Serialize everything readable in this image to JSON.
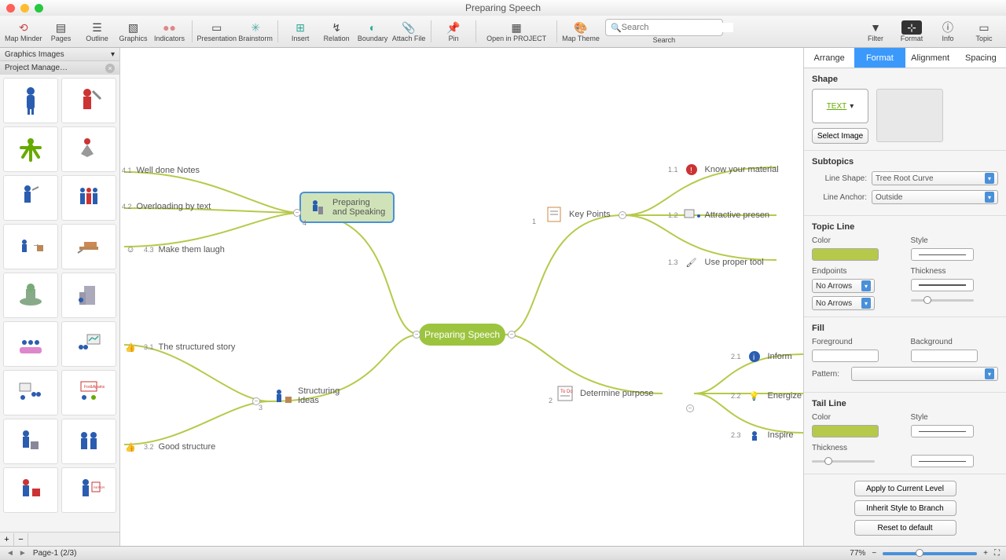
{
  "window": {
    "title": "Preparing Speech"
  },
  "toolbar": {
    "map_minder": "Map Minder",
    "pages": "Pages",
    "outline": "Outline",
    "graphics": "Graphics",
    "indicators": "Indicators",
    "presentation": "Presentation",
    "brainstorm": "Brainstorm",
    "insert": "Insert",
    "relation": "Relation",
    "boundary": "Boundary",
    "attach_file": "Attach File",
    "pin": "Pin",
    "open_project": "Open in PROJECT",
    "map_theme": "Map Theme",
    "search": "Search",
    "search_placeholder": "Search",
    "filter": "Filter",
    "format": "Format",
    "info": "Info",
    "topic": "Topic"
  },
  "left": {
    "header": "Graphics Images",
    "tab": "Project Manage…"
  },
  "mindmap": {
    "central": "Preparing Speech",
    "n4": {
      "num": "4",
      "label": "Preparing\nand Speaking"
    },
    "n41": {
      "num": "4.1",
      "label": "Well done Notes"
    },
    "n42": {
      "num": "4.2",
      "label": "Overloading by text"
    },
    "n43": {
      "num": "4.3",
      "label": "Make them laugh"
    },
    "n3": {
      "num": "3",
      "label": "Structuring\nIdeas"
    },
    "n31": {
      "num": "3.1",
      "label": "The structured story"
    },
    "n32": {
      "num": "3.2",
      "label": "Good structure"
    },
    "n1": {
      "num": "1",
      "label": "Key Points"
    },
    "n11": {
      "num": "1.1",
      "label": "Know your material"
    },
    "n12": {
      "num": "1.2",
      "label": "Attractive presen"
    },
    "n13": {
      "num": "1.3",
      "label": "Use proper tool"
    },
    "n2": {
      "num": "2",
      "label": "Determine purpose"
    },
    "n21": {
      "num": "2.1",
      "label": "Inform"
    },
    "n22": {
      "num": "2.2",
      "label": "Energize"
    },
    "n23": {
      "num": "2.3",
      "label": "Inspire"
    }
  },
  "right": {
    "tabs": [
      "Arrange",
      "Format",
      "Alignment",
      "Spacing"
    ],
    "shape_h": "Shape",
    "shape_text": "TEXT",
    "select_image": "Select Image",
    "subtopics_h": "Subtopics",
    "line_shape_l": "Line Shape:",
    "line_shape_v": "Tree Root Curve",
    "line_anchor_l": "Line Anchor:",
    "line_anchor_v": "Outside",
    "topic_line_h": "Topic Line",
    "color_l": "Color",
    "style_l": "Style",
    "endpoints_l": "Endpoints",
    "thickness_l": "Thickness",
    "no_arrows": "No Arrows",
    "fill_h": "Fill",
    "foreground_l": "Foreground",
    "background_l": "Background",
    "pattern_l": "Pattern:",
    "tail_h": "Tail Line",
    "btn_apply": "Apply to Current Level",
    "btn_inherit": "Inherit Style to Branch",
    "btn_reset": "Reset to default"
  },
  "status": {
    "page": "Page-1 (2/3)",
    "zoom": "77%"
  }
}
